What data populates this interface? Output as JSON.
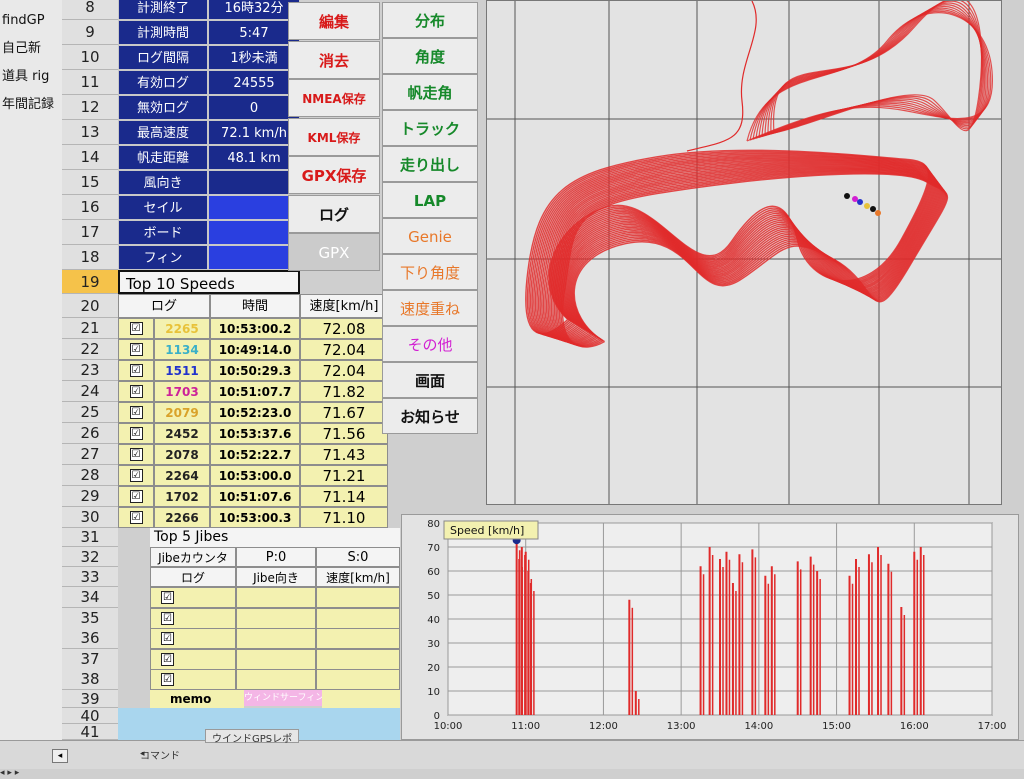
{
  "left_column": [
    "findGP",
    "自己新",
    "道具 rig",
    "年間記録"
  ],
  "info_rows": [
    {
      "num": "8",
      "label": "計測終了",
      "value": "16時32分"
    },
    {
      "num": "9",
      "label": "計測時間",
      "value": "5:47"
    },
    {
      "num": "10",
      "label": "ログ間隔",
      "value": "1秒未満"
    },
    {
      "num": "11",
      "label": "有効ログ",
      "value": "24555"
    },
    {
      "num": "12",
      "label": "無効ログ",
      "value": "0"
    },
    {
      "num": "13",
      "label": "最高速度",
      "value": "72.1 km/h"
    },
    {
      "num": "14",
      "label": "帆走距離",
      "value": "48.1 km"
    },
    {
      "num": "15",
      "label": "風向き",
      "value": ""
    },
    {
      "num": "16",
      "label": "セイル",
      "value": ""
    },
    {
      "num": "17",
      "label": "ボード",
      "value": ""
    },
    {
      "num": "18",
      "label": "フィン",
      "value": ""
    }
  ],
  "top10": {
    "row_num": "19",
    "title": "Top 10 Speeds",
    "header_row_num": "20",
    "headers": [
      "ログ",
      "時間",
      "速度[km/h]"
    ],
    "rows": [
      {
        "num": "21",
        "check": "☑",
        "log": "2265",
        "time": "10:53:00.2",
        "speed": "72.08",
        "log_color": "#e8c23a"
      },
      {
        "num": "22",
        "check": "☑",
        "log": "1134",
        "time": "10:49:14.0",
        "speed": "72.04",
        "log_color": "#3ab0c8"
      },
      {
        "num": "23",
        "check": "☑",
        "log": "1511",
        "time": "10:50:29.3",
        "speed": "72.04",
        "log_color": "#2233cc"
      },
      {
        "num": "24",
        "check": "☑",
        "log": "1703",
        "time": "10:51:07.7",
        "speed": "71.82",
        "log_color": "#cc2299"
      },
      {
        "num": "25",
        "check": "☑",
        "log": "2079",
        "time": "10:52:23.0",
        "speed": "71.67",
        "log_color": "#d9a22a"
      },
      {
        "num": "26",
        "check": "☑",
        "log": "2452",
        "time": "10:53:37.6",
        "speed": "71.56",
        "log_color": "#222222"
      },
      {
        "num": "27",
        "check": "☑",
        "log": "2078",
        "time": "10:52:22.7",
        "speed": "71.43",
        "log_color": "#222222"
      },
      {
        "num": "28",
        "check": "☑",
        "log": "2264",
        "time": "10:53:00.0",
        "speed": "71.21",
        "log_color": "#222222"
      },
      {
        "num": "29",
        "check": "☑",
        "log": "1702",
        "time": "10:51:07.6",
        "speed": "71.14",
        "log_color": "#222222"
      },
      {
        "num": "30",
        "check": "☑",
        "log": "2266",
        "time": "10:53:00.3",
        "speed": "71.10",
        "log_color": "#222222"
      }
    ]
  },
  "jibes": {
    "title_row_num": "31",
    "title": "Top 5 Jibes",
    "counter_row_num": "32",
    "counter_label": "Jibeカウンタ",
    "p_label": "P:0",
    "s_label": "S:0",
    "header_row_num": "33",
    "headers": [
      "ログ",
      "Jibe向き",
      "速度[km/h]"
    ],
    "rows": [
      {
        "num": "34",
        "check": "☑"
      },
      {
        "num": "35",
        "check": "☑"
      },
      {
        "num": "36",
        "check": "☑"
      },
      {
        "num": "37",
        "check": "☑"
      },
      {
        "num": "38",
        "check": "☑"
      }
    ]
  },
  "memo": {
    "num": "39",
    "label": "memo",
    "pink_text": "ウィンドサーフィン"
  },
  "extra_rows": [
    "40",
    "41"
  ],
  "sheet_tab": "ウインドGPSレポ",
  "status_text": "コマンド",
  "buttons_col1": [
    {
      "label": "編集",
      "style": "red"
    },
    {
      "label": "消去",
      "style": "red"
    },
    {
      "label": "NMEA保存",
      "style": "red"
    },
    {
      "label": "KML保存",
      "style": "red"
    },
    {
      "label": "GPX保存",
      "style": "red"
    },
    {
      "label": "ログ",
      "style": "black"
    },
    {
      "label": "GPX",
      "style": "grey"
    }
  ],
  "buttons_col2": [
    {
      "label": "分布",
      "style": "green"
    },
    {
      "label": "角度",
      "style": "green"
    },
    {
      "label": "帆走角",
      "style": "green"
    },
    {
      "label": "トラック",
      "style": "green"
    },
    {
      "label": "走り出し",
      "style": "green"
    },
    {
      "label": "LAP",
      "style": "green"
    },
    {
      "label": "Genie",
      "style": "orange"
    },
    {
      "label": "下り角度",
      "style": "orange"
    },
    {
      "label": "速度重ね",
      "style": "orange"
    },
    {
      "label": "その他",
      "style": "magenta"
    },
    {
      "label": "画面",
      "style": "black"
    },
    {
      "label": "お知らせ",
      "style": "black"
    }
  ],
  "colors": {
    "track": "#e02a2a",
    "navy": "#1a2a8c",
    "yellow": "#f3f1b0"
  },
  "chart_data": {
    "type": "line",
    "title": "Speed [km/h]",
    "xlabel": "",
    "ylabel": "",
    "ylim": [
      0,
      80
    ],
    "yticks": [
      "0",
      "10",
      "20",
      "30",
      "40",
      "50",
      "60",
      "70",
      "80"
    ],
    "xticks": [
      "10:00",
      "11:00",
      "12:00",
      "13:00",
      "14:00",
      "15:00",
      "16:00",
      "17:00"
    ],
    "series": [
      {
        "x": [
          "10:53",
          "10:55",
          "10:57",
          "11:00",
          "11:02",
          "11:04",
          "12:20",
          "12:25",
          "13:15",
          "13:22",
          "13:30",
          "13:35",
          "13:40",
          "13:45",
          "13:55",
          "14:05",
          "14:10",
          "14:30",
          "14:40",
          "14:45",
          "15:10",
          "15:15",
          "15:25",
          "15:32",
          "15:40",
          "15:50",
          "16:00",
          "16:05"
        ],
        "values": [
          72,
          65,
          70,
          68,
          60,
          55,
          48,
          10,
          62,
          70,
          65,
          68,
          55,
          67,
          69,
          58,
          62,
          64,
          66,
          60,
          58,
          65,
          67,
          70,
          63,
          45,
          68,
          70
        ]
      }
    ]
  }
}
